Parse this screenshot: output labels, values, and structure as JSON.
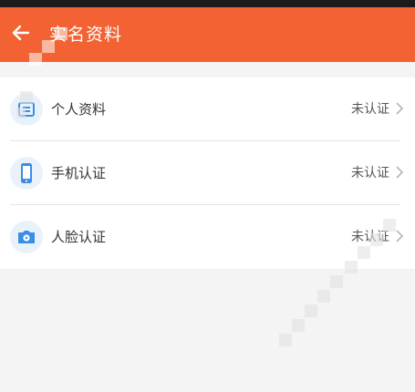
{
  "header": {
    "title": "实名资料"
  },
  "rows": [
    {
      "label": "个人资料",
      "status": "未认证",
      "icon": "id-card-icon"
    },
    {
      "label": "手机认证",
      "status": "未认证",
      "icon": "phone-icon"
    },
    {
      "label": "人脸认证",
      "status": "未认证",
      "icon": "camera-icon"
    }
  ],
  "colors": {
    "accent": "#f26232",
    "icon_blue": "#3a8ee6",
    "icon_bg": "#e9f2fb"
  }
}
